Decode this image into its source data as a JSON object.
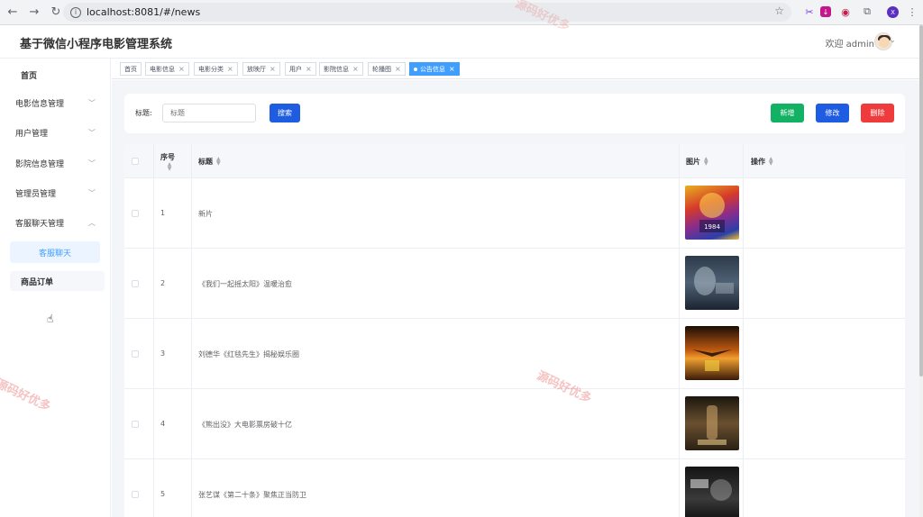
{
  "browser": {
    "url": "localhost:8081/#/news",
    "profile_initial": "X"
  },
  "header": {
    "title": "基于微信小程序电影管理系统",
    "welcome": "欢迎 admin"
  },
  "sidebar": {
    "items": [
      {
        "label": "首页"
      },
      {
        "label": "电影信息管理"
      },
      {
        "label": "用户管理"
      },
      {
        "label": "影院信息管理"
      },
      {
        "label": "管理员管理"
      },
      {
        "label": "客服聊天管理"
      }
    ],
    "sub_active": "客服聊天",
    "sub_other": "商品订单"
  },
  "tags": [
    {
      "label": "首页",
      "closable": false
    },
    {
      "label": "电影信息",
      "closable": true
    },
    {
      "label": "电影分类",
      "closable": true
    },
    {
      "label": "放映厅",
      "closable": true
    },
    {
      "label": "用户",
      "closable": true
    },
    {
      "label": "影院信息",
      "closable": true
    },
    {
      "label": "轮播图",
      "closable": true
    },
    {
      "label": "公告信息",
      "closable": true,
      "active": true
    }
  ],
  "search": {
    "label": "标题:",
    "placeholder": "标题",
    "search_button": "搜索"
  },
  "actions": {
    "add": "新增",
    "edit": "修改",
    "delete": "删除"
  },
  "table": {
    "columns": {
      "index": "序号",
      "title": "标题",
      "image": "图片",
      "ops": "操作"
    },
    "rows": [
      {
        "index": "1",
        "title": "新片",
        "poster": "poster-wonder-woman"
      },
      {
        "index": "2",
        "title": "《我们一起摇太阳》温暖治愈",
        "poster": "poster-dark-blue"
      },
      {
        "index": "3",
        "title": "刘德华《红毯先生》揭秘娱乐圈",
        "poster": "poster-127-hours"
      },
      {
        "index": "4",
        "title": "《熊出没》大电影票房破十亿",
        "poster": "poster-i-am-legend"
      },
      {
        "index": "5",
        "title": "张艺谋《第二十条》聚焦正当防卫",
        "poster": "poster-dark-chinese"
      }
    ]
  },
  "watermark": "源码好优多",
  "colors": {
    "primary": "#1e5ce1",
    "success": "#13b164",
    "danger": "#ef3b3b",
    "tag_active": "#409eff"
  }
}
